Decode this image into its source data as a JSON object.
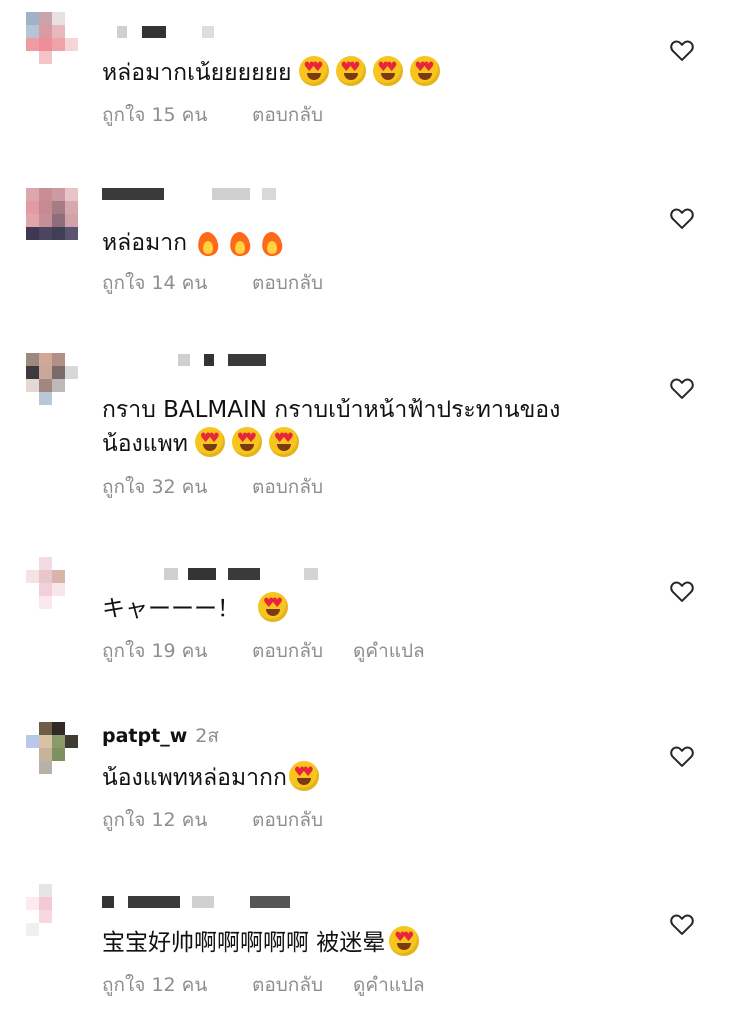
{
  "comments": [
    {
      "username": "",
      "time": "",
      "text": "หล่อมากเน้ยยยยยย",
      "emojis": [
        "heart-eyes",
        "heart-eyes",
        "heart-eyes",
        "heart-eyes"
      ],
      "likes_label": "ถูกใจ 15 คน",
      "reply_label": "ตอบกลับ",
      "translate_label": ""
    },
    {
      "username": "",
      "time": "",
      "text": "หล่อมาก",
      "emojis": [
        "fire",
        "fire",
        "fire"
      ],
      "likes_label": "ถูกใจ 14 คน",
      "reply_label": "ตอบกลับ",
      "translate_label": ""
    },
    {
      "username": "",
      "time": "",
      "text_line1": "กราบ BALMAIN กราบเบ้าหน้าฟ้าประทานของ",
      "text": "น้องแพท",
      "emojis": [
        "heart-eyes",
        "heart-eyes",
        "heart-eyes"
      ],
      "likes_label": "ถูกใจ 32 คน",
      "reply_label": "ตอบกลับ",
      "translate_label": ""
    },
    {
      "username": "",
      "time": "",
      "text": "キャーーー！",
      "emojis": [
        "heart-eyes"
      ],
      "likes_label": "ถูกใจ 19 คน",
      "reply_label": "ตอบกลับ",
      "translate_label": "ดูคำแปล"
    },
    {
      "username": "patpt_w",
      "time": "2ส",
      "text": "น้องแพทหล่อมากก",
      "emojis": [
        "heart-eyes"
      ],
      "likes_label": "ถูกใจ 12 คน",
      "reply_label": "ตอบกลับ",
      "translate_label": ""
    },
    {
      "username": "",
      "time": "",
      "text": "宝宝好帅啊啊啊啊啊 被迷晕",
      "emojis": [
        "heart-eyes"
      ],
      "likes_label": "ถูกใจ 12 คน",
      "reply_label": "ตอบกลับ",
      "translate_label": "ดูคำแปล"
    }
  ],
  "icons": {
    "like": "heart-outline-icon",
    "heart_eyes": "heart-eyes-emoji-icon",
    "fire": "fire-emoji-icon"
  },
  "colors": {
    "text": "#111111",
    "secondary": "#8e8e8e",
    "emoji_face": "#f7c51e",
    "emoji_heart": "#e9253b",
    "background": "#ffffff"
  }
}
